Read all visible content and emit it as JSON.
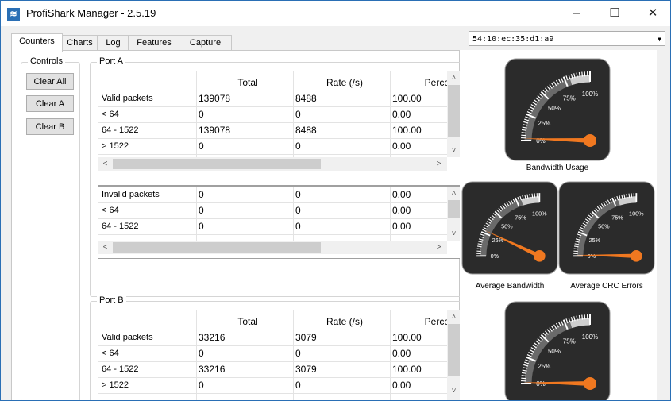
{
  "window": {
    "title": "ProfiShark Manager - 2.5.19",
    "app_icon": "profishark-logo-icon",
    "controls": [
      "minimize-icon",
      "maximize-icon",
      "close-icon"
    ]
  },
  "tabs": [
    {
      "label": "Counters",
      "active": true
    },
    {
      "label": "Charts",
      "active": false
    },
    {
      "label": "Log",
      "active": false
    },
    {
      "label": "Features",
      "active": false
    },
    {
      "label": "Capture",
      "active": false
    }
  ],
  "device_select": {
    "value": "54:10:ec:35:d1:a9"
  },
  "controls_group": {
    "label": "Controls",
    "clear_all": "Clear All",
    "clear_a": "Clear A",
    "clear_b": "Clear B"
  },
  "port_a": {
    "label": "Port A",
    "valid_table": {
      "headers": [
        "",
        "Total",
        "Rate (/s)",
        "Perce"
      ],
      "rows": [
        [
          "Valid packets",
          "139078",
          "8488",
          "100.00"
        ],
        [
          "< 64",
          "0",
          "0",
          "0.00"
        ],
        [
          "64 - 1522",
          "139078",
          "8488",
          "100.00"
        ],
        [
          "> 1522",
          "0",
          "0",
          "0.00"
        ]
      ]
    },
    "invalid_table": {
      "rows": [
        [
          "Invalid packets",
          "0",
          "0",
          "0.00"
        ],
        [
          "< 64",
          "0",
          "0",
          "0.00"
        ],
        [
          "64 - 1522",
          "0",
          "0",
          "0.00"
        ]
      ]
    }
  },
  "port_b": {
    "label": "Port B",
    "valid_table": {
      "headers": [
        "",
        "Total",
        "Rate (/s)",
        "Perce"
      ],
      "rows": [
        [
          "Valid packets",
          "33216",
          "3079",
          "100.00"
        ],
        [
          "< 64",
          "0",
          "0",
          "0.00"
        ],
        [
          "64 - 1522",
          "33216",
          "3079",
          "100.00"
        ],
        [
          "> 1522",
          "0",
          "0",
          "0.00"
        ]
      ]
    }
  },
  "gauges": {
    "scale_labels": [
      "0%",
      "25%",
      "50%",
      "75%",
      "100%"
    ],
    "bandwidth_usage": {
      "caption": "Bandwidth Usage",
      "value_percent": 2
    },
    "average_bandwidth": {
      "caption": "Average Bandwidth",
      "value_percent": 28
    },
    "average_crc_errors": {
      "caption": "Average CRC Errors",
      "value_percent": 1
    },
    "port_b_bandwidth": {
      "value_percent": 1
    }
  },
  "colors": {
    "accent": "#2a6fb5",
    "needle": "#f07820",
    "gauge_body": "#2b2b2b"
  }
}
